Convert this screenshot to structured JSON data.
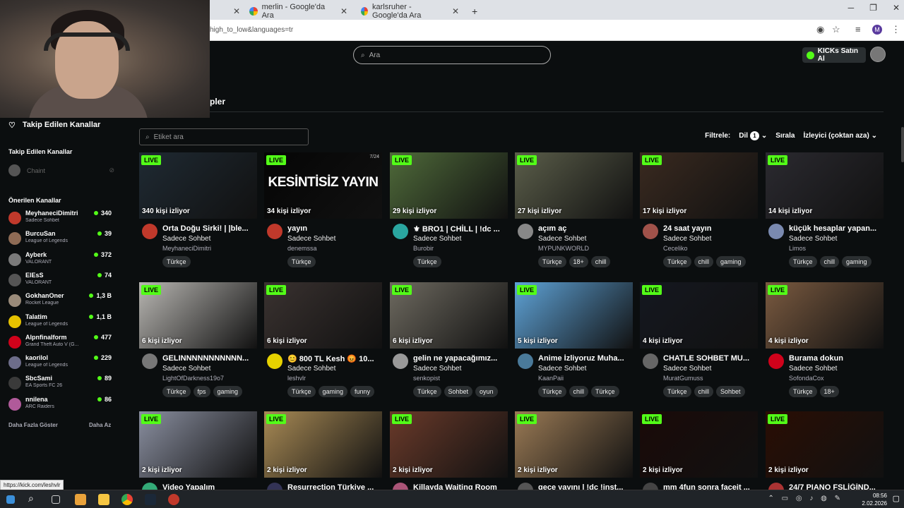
{
  "browser": {
    "tabs": [
      {
        "title": "merlin - Google'da Ara"
      },
      {
        "title": "karlsruher - Google'da Ara"
      }
    ],
    "new_tab": "+",
    "url": "high_to_low&languages=tr",
    "profile_initial": "M"
  },
  "header": {
    "search_placeholder": "Ara",
    "kicks_button": "KICKs Satın Al"
  },
  "page": {
    "title": "pler"
  },
  "sidebar": {
    "followed_top_label": "Takip Edilen Kanallar",
    "followed_heading": "Takip Edilen Kanallar",
    "followed_channel": "Chaint",
    "recommended_heading": "Önerilen Kanallar",
    "recommended": [
      {
        "name": "MeyhaneciDimitri",
        "category": "Sadece Sohbet",
        "viewers": "340",
        "color": "#c0392b"
      },
      {
        "name": "BurcuSan",
        "category": "League of Legends",
        "viewers": "39",
        "color": "#8e6b55"
      },
      {
        "name": "Ayberk",
        "category": "VALORANT",
        "viewers": "372",
        "color": "#7a7a7a"
      },
      {
        "name": "ElEsS",
        "category": "VALORANT",
        "viewers": "74",
        "color": "#555"
      },
      {
        "name": "GokhanOner",
        "category": "Rocket League",
        "viewers": "1,3 B",
        "color": "#9a8b7a"
      },
      {
        "name": "Talatim",
        "category": "League of Legends",
        "viewers": "1,1 B",
        "color": "#e6c200"
      },
      {
        "name": "Alpnfinalform",
        "category": "Grand Theft Auto V (G...",
        "viewers": "477",
        "color": "#d0021b"
      },
      {
        "name": "kaorilol",
        "category": "League of Legends",
        "viewers": "229",
        "color": "#6d6d8a"
      },
      {
        "name": "SbcSami",
        "category": "EA Sports FC 26",
        "viewers": "89",
        "color": "#3a3a3a"
      },
      {
        "name": "nnilena",
        "category": "ARC Raiders",
        "viewers": "86",
        "color": "#b05a9a"
      }
    ],
    "show_more": "Daha Fazla Göster",
    "show_less": "Daha Az"
  },
  "filters": {
    "tag_search_placeholder": "Etiket ara",
    "filter_label": "Filtrele:",
    "language_label": "Dil",
    "language_count": "1",
    "sort_label": "Sırala",
    "sort_value": "İzleyici (çoktan aza)"
  },
  "live_badge": "LIVE",
  "streams": [
    {
      "viewers": "340 kişi izliyor",
      "title": "Orta Doğu Sirki! | |ble...",
      "category": "Sadece Sohbet",
      "channel": "MeyhaneciDimitri",
      "tags": [
        "Türkçe"
      ],
      "thumb": "#1f2a33",
      "avatar": "#c0392b"
    },
    {
      "viewers": "34 kişi izliyor",
      "title": "yayın",
      "category": "Sadece Sohbet",
      "channel": "denemssa",
      "tags": [
        "Türkçe"
      ],
      "thumb": "#050505",
      "avatar": "#c0392b",
      "overlay": "KESİNTİSİZ YAYIN",
      "corner": "7/24"
    },
    {
      "viewers": "29 kişi izliyor",
      "title": "⚜ BRO1 | CHİLL | !dc ...",
      "category": "Sadece Sohbet",
      "channel": "Burobir",
      "tags": [
        "Türkçe"
      ],
      "thumb": "#4f6a3a",
      "avatar": "#2aa6a0"
    },
    {
      "viewers": "27 kişi izliyor",
      "title": "açım aç",
      "category": "Sadece Sohbet",
      "channel": "MYPUNKWORLD",
      "tags": [
        "Türkçe",
        "18+",
        "chill"
      ],
      "thumb": "#5b5e4a",
      "avatar": "#888"
    },
    {
      "viewers": "17 kişi izliyor",
      "title": "24 saat yayın",
      "category": "Sadece Sohbet",
      "channel": "Ceceliko",
      "tags": [
        "Türkçe",
        "chill",
        "gaming"
      ],
      "thumb": "#3a2a20",
      "avatar": "#a0524a"
    },
    {
      "viewers": "14 kişi izliyor",
      "title": "küçük hesaplar yapan...",
      "category": "Sadece Sohbet",
      "channel": "Limos",
      "tags": [
        "Türkçe",
        "chill",
        "gaming"
      ],
      "thumb": "#2b2a30",
      "avatar": "#7a8ab0"
    },
    {
      "viewers": "6 kişi izliyor",
      "title": "GELINNNNNNNNNNN...",
      "category": "Sadece Sohbet",
      "channel": "LightOfDarkness19o7",
      "tags": [
        "Türkçe",
        "fps",
        "gaming"
      ],
      "thumb": "#b8b6b2",
      "avatar": "#777"
    },
    {
      "viewers": "6 kişi izliyor",
      "title": "😊 800 TL Kesh 😡 10...",
      "category": "Sadece Sohbet",
      "channel": "leshvlr",
      "tags": [
        "Türkçe",
        "gaming",
        "funny"
      ],
      "thumb": "#3a3230",
      "avatar": "#e6d200"
    },
    {
      "viewers": "6 kişi izliyor",
      "title": "gelin ne yapacağımız...",
      "category": "Sadece Sohbet",
      "channel": "senkopist",
      "tags": [
        "Türkçe",
        "Sohbet",
        "oyun"
      ],
      "thumb": "#6e6a60",
      "avatar": "#999"
    },
    {
      "viewers": "5 kişi izliyor",
      "title": "Anime İzliyoruz Muha...",
      "category": "Sadece Sohbet",
      "channel": "KaanPaii",
      "tags": [
        "Türkçe",
        "chill",
        "Türkçe"
      ],
      "thumb": "#5ea2d6",
      "avatar": "#4a7a9a"
    },
    {
      "viewers": "4 kişi izliyor",
      "title": "CHATLE SOHBET MU...",
      "category": "Sadece Sohbet",
      "channel": "MuratGumuss",
      "tags": [
        "Türkçe",
        "chill",
        "Sohbet"
      ],
      "thumb": "#151820",
      "avatar": "#666"
    },
    {
      "viewers": "4 kişi izliyor",
      "title": "Burama dokun",
      "category": "Sadece Sohbet",
      "channel": "SofondaCox",
      "tags": [
        "Türkçe",
        "18+"
      ],
      "thumb": "#7a5a40",
      "avatar": "#d0021b"
    },
    {
      "viewers": "2 kişi izliyor",
      "title": "Video Yapalım",
      "thumb": "#8a8fa0",
      "avatar": "#3a7"
    },
    {
      "viewers": "2 kişi izliyor",
      "title": "Resurrection Türkiye ...",
      "thumb": "#a88a55",
      "avatar": "#335"
    },
    {
      "viewers": "2 kişi izliyor",
      "title": "Killayda Waiting Room",
      "thumb": "#6a3a2a",
      "avatar": "#a57"
    },
    {
      "viewers": "2 kişi izliyor",
      "title": "gece yayını | !dc !inst...",
      "thumb": "#9a7a55",
      "avatar": "#555"
    },
    {
      "viewers": "2 kişi izliyor",
      "title": "mm 4fun sonra faceit ...",
      "thumb": "#1a0a08",
      "avatar": "#444"
    },
    {
      "viewers": "2 kişi izliyor",
      "title": "24/7 PIANO FSLİĞİND...",
      "thumb": "#2a0e04",
      "avatar": "#a33"
    }
  ],
  "status_url": "https://kick.com/leshvlr",
  "taskbar": {
    "time": "08:56",
    "date": "2.02.2026"
  }
}
